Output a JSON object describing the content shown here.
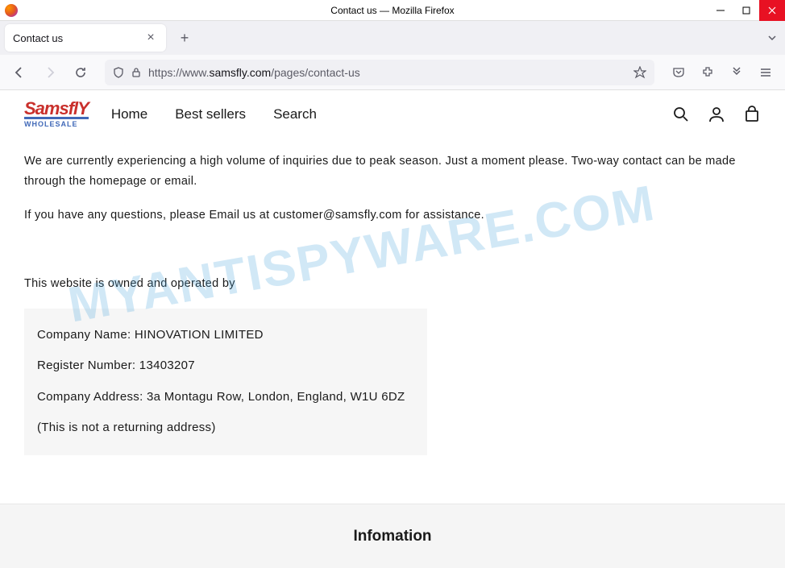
{
  "window": {
    "title": "Contact us — Mozilla Firefox"
  },
  "tab": {
    "title": "Contact us"
  },
  "url": {
    "prefix": "https://www.",
    "domain": "samsfly.com",
    "path": "/pages/contact-us"
  },
  "logo": {
    "main": "SamsflY",
    "sub": "WHOLESALE"
  },
  "nav": {
    "home": "Home",
    "bestsellers": "Best sellers",
    "search": "Search"
  },
  "content": {
    "p1": "We are currently experiencing a high volume of inquiries due to peak season. Just a moment please. Two-way contact can be made through the homepage or email.",
    "p2": "If you have any questions, please Email us at customer@samsfly.com for assistance.",
    "p3": "This website is owned and operated by",
    "company_name": "Company Name: HINOVATION LIMITED",
    "register": "Register Number: 13403207",
    "address": "Company Address: 3a Montagu Row, London, England, W1U 6DZ",
    "note": "(This is not a returning address)"
  },
  "footer": {
    "title": "Infomation"
  },
  "watermark": "MYANTISPYWARE.COM"
}
